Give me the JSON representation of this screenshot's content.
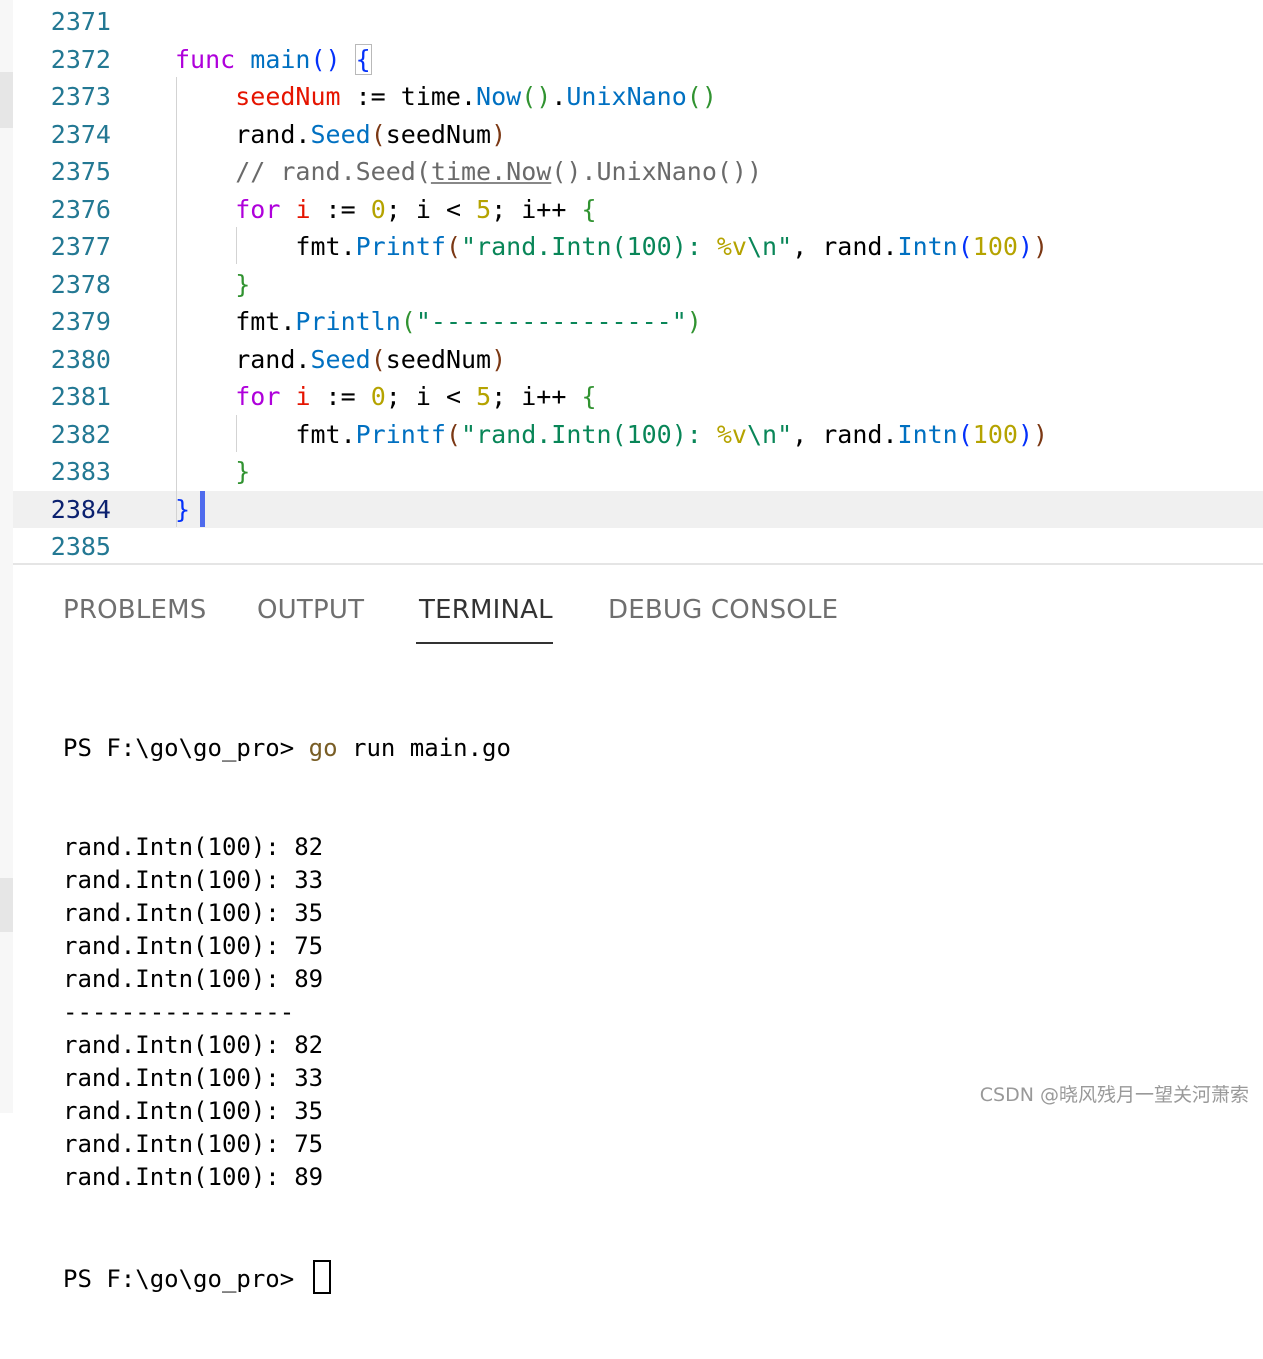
{
  "editor": {
    "lines": [
      {
        "n": "2371",
        "segs": []
      },
      {
        "n": "2372",
        "segs": [
          {
            "t": "func",
            "c": "kw"
          },
          {
            "t": " "
          },
          {
            "t": "main",
            "c": "fn"
          },
          {
            "t": "()",
            "c": "b1"
          },
          {
            "t": " "
          },
          {
            "t": "{",
            "c": "b1 bx"
          }
        ]
      },
      {
        "n": "2373",
        "segs": [
          {
            "t": "    "
          },
          {
            "t": "seedNum",
            "c": "var"
          },
          {
            "t": " := time."
          },
          {
            "t": "Now",
            "c": "fn"
          },
          {
            "t": "()",
            "c": "b2"
          },
          {
            "t": "."
          },
          {
            "t": "UnixNano",
            "c": "fn"
          },
          {
            "t": "()",
            "c": "b2"
          }
        ]
      },
      {
        "n": "2374",
        "segs": [
          {
            "t": "    rand."
          },
          {
            "t": "Seed",
            "c": "fn"
          },
          {
            "t": "(",
            "c": "b3"
          },
          {
            "t": "seedNum"
          },
          {
            "t": ")",
            "c": "b3"
          }
        ]
      },
      {
        "n": "2375",
        "segs": [
          {
            "t": "    "
          },
          {
            "t": "// rand.Seed(",
            "c": "cm"
          },
          {
            "t": "time.Now",
            "c": "cm ul"
          },
          {
            "t": "().UnixNano())",
            "c": "cm"
          }
        ]
      },
      {
        "n": "2376",
        "segs": [
          {
            "t": "    "
          },
          {
            "t": "for",
            "c": "kw"
          },
          {
            "t": " "
          },
          {
            "t": "i",
            "c": "var"
          },
          {
            "t": " := "
          },
          {
            "t": "0",
            "c": "num2"
          },
          {
            "t": "; i < "
          },
          {
            "t": "5",
            "c": "num2"
          },
          {
            "t": "; i++ "
          },
          {
            "t": "{",
            "c": "b2"
          }
        ]
      },
      {
        "n": "2377",
        "segs": [
          {
            "t": "        fmt."
          },
          {
            "t": "Printf",
            "c": "fn"
          },
          {
            "t": "(",
            "c": "b3"
          },
          {
            "t": "\"rand.Intn(100): ",
            "c": "num"
          },
          {
            "t": "%v",
            "c": "num2"
          },
          {
            "t": "\\n",
            "c": "num"
          },
          {
            "t": "\"",
            "c": "num"
          },
          {
            "t": ", rand."
          },
          {
            "t": "Intn",
            "c": "fn"
          },
          {
            "t": "(",
            "c": "b1"
          },
          {
            "t": "100",
            "c": "num2"
          },
          {
            "t": ")",
            "c": "b1"
          },
          {
            "t": ")",
            "c": "b3"
          }
        ]
      },
      {
        "n": "2378",
        "segs": [
          {
            "t": "    "
          },
          {
            "t": "}",
            "c": "b2"
          }
        ]
      },
      {
        "n": "2379",
        "segs": [
          {
            "t": "    fmt."
          },
          {
            "t": "Println",
            "c": "fn"
          },
          {
            "t": "(",
            "c": "b2"
          },
          {
            "t": "\"----------------\"",
            "c": "num"
          },
          {
            "t": ")",
            "c": "b2"
          }
        ]
      },
      {
        "n": "2380",
        "segs": [
          {
            "t": "    rand."
          },
          {
            "t": "Seed",
            "c": "fn"
          },
          {
            "t": "(",
            "c": "b3"
          },
          {
            "t": "seedNum"
          },
          {
            "t": ")",
            "c": "b3"
          }
        ]
      },
      {
        "n": "2381",
        "segs": [
          {
            "t": "    "
          },
          {
            "t": "for",
            "c": "kw"
          },
          {
            "t": " "
          },
          {
            "t": "i",
            "c": "var"
          },
          {
            "t": " := "
          },
          {
            "t": "0",
            "c": "num2"
          },
          {
            "t": "; i < "
          },
          {
            "t": "5",
            "c": "num2"
          },
          {
            "t": "; i++ "
          },
          {
            "t": "{",
            "c": "b2"
          }
        ]
      },
      {
        "n": "2382",
        "segs": [
          {
            "t": "        fmt."
          },
          {
            "t": "Printf",
            "c": "fn"
          },
          {
            "t": "(",
            "c": "b3"
          },
          {
            "t": "\"rand.Intn(100): ",
            "c": "num"
          },
          {
            "t": "%v",
            "c": "num2"
          },
          {
            "t": "\\n",
            "c": "num"
          },
          {
            "t": "\"",
            "c": "num"
          },
          {
            "t": ", rand."
          },
          {
            "t": "Intn",
            "c": "fn"
          },
          {
            "t": "(",
            "c": "b1"
          },
          {
            "t": "100",
            "c": "num2"
          },
          {
            "t": ")",
            "c": "b1"
          },
          {
            "t": ")",
            "c": "b3"
          }
        ]
      },
      {
        "n": "2383",
        "segs": [
          {
            "t": "    "
          },
          {
            "t": "}",
            "c": "b2"
          }
        ]
      },
      {
        "n": "2384",
        "current": true,
        "segs": [
          {
            "t": "}",
            "c": "b1"
          }
        ]
      },
      {
        "n": "2385",
        "segs": []
      }
    ]
  },
  "panel": {
    "tabs": [
      {
        "label": "PROBLEMS"
      },
      {
        "label": "OUTPUT"
      },
      {
        "label": "TERMINAL",
        "active": true
      },
      {
        "label": "DEBUG CONSOLE"
      }
    ],
    "terminal": {
      "prompt": "PS F:\\go\\go_pro> ",
      "command_go": "go",
      "command_rest": " run main.go",
      "output_lines": [
        "rand.Intn(100): 82",
        "rand.Intn(100): 33",
        "rand.Intn(100): 35",
        "rand.Intn(100): 75",
        "rand.Intn(100): 89",
        "----------------",
        "rand.Intn(100): 82",
        "rand.Intn(100): 33",
        "rand.Intn(100): 35",
        "rand.Intn(100): 75",
        "rand.Intn(100): 89"
      ],
      "final_prompt": "PS F:\\go\\go_pro> "
    }
  },
  "watermark": "CSDN @晓风残月一望关河萧索"
}
